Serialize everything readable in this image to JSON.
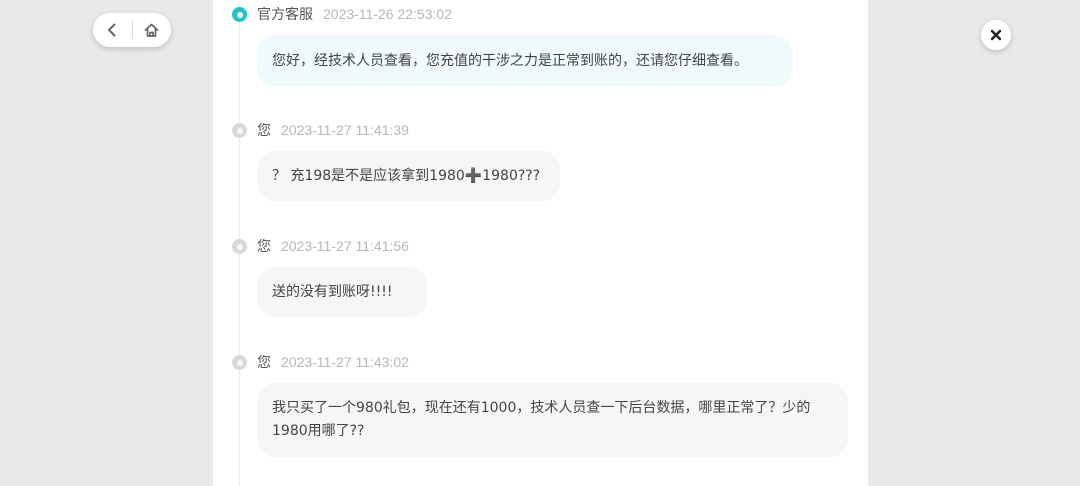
{
  "nav": {
    "back_icon": "chevron-left-icon",
    "home_icon": "home-icon",
    "close_icon": "close-icon"
  },
  "colors": {
    "accent": "#22c2cb",
    "official_bubble": "#eefafc",
    "user_bubble": "#f6f6f6",
    "timestamp": "#b7b7b7",
    "background": "#e9e9e9"
  },
  "messages": [
    {
      "sender": "官方客服",
      "time": "2023-11-26 22:53:02",
      "text": "您好，经技术人员查看，您充值的干涉之力是正常到账的，还请您仔细查看。",
      "role": "official"
    },
    {
      "sender": "您",
      "time": "2023-11-27 11:41:39",
      "text": "？ 充198是不是应该拿到1980➕1980???",
      "role": "user"
    },
    {
      "sender": "您",
      "time": "2023-11-27 11:41:56",
      "text": "送的没有到账呀!!!!",
      "role": "user"
    },
    {
      "sender": "您",
      "time": "2023-11-27 11:43:02",
      "text": "我只买了一个980礼包，现在还有1000，技术人员查一下后台数据，哪里正常了？少的1980用哪了??",
      "role": "user"
    }
  ]
}
